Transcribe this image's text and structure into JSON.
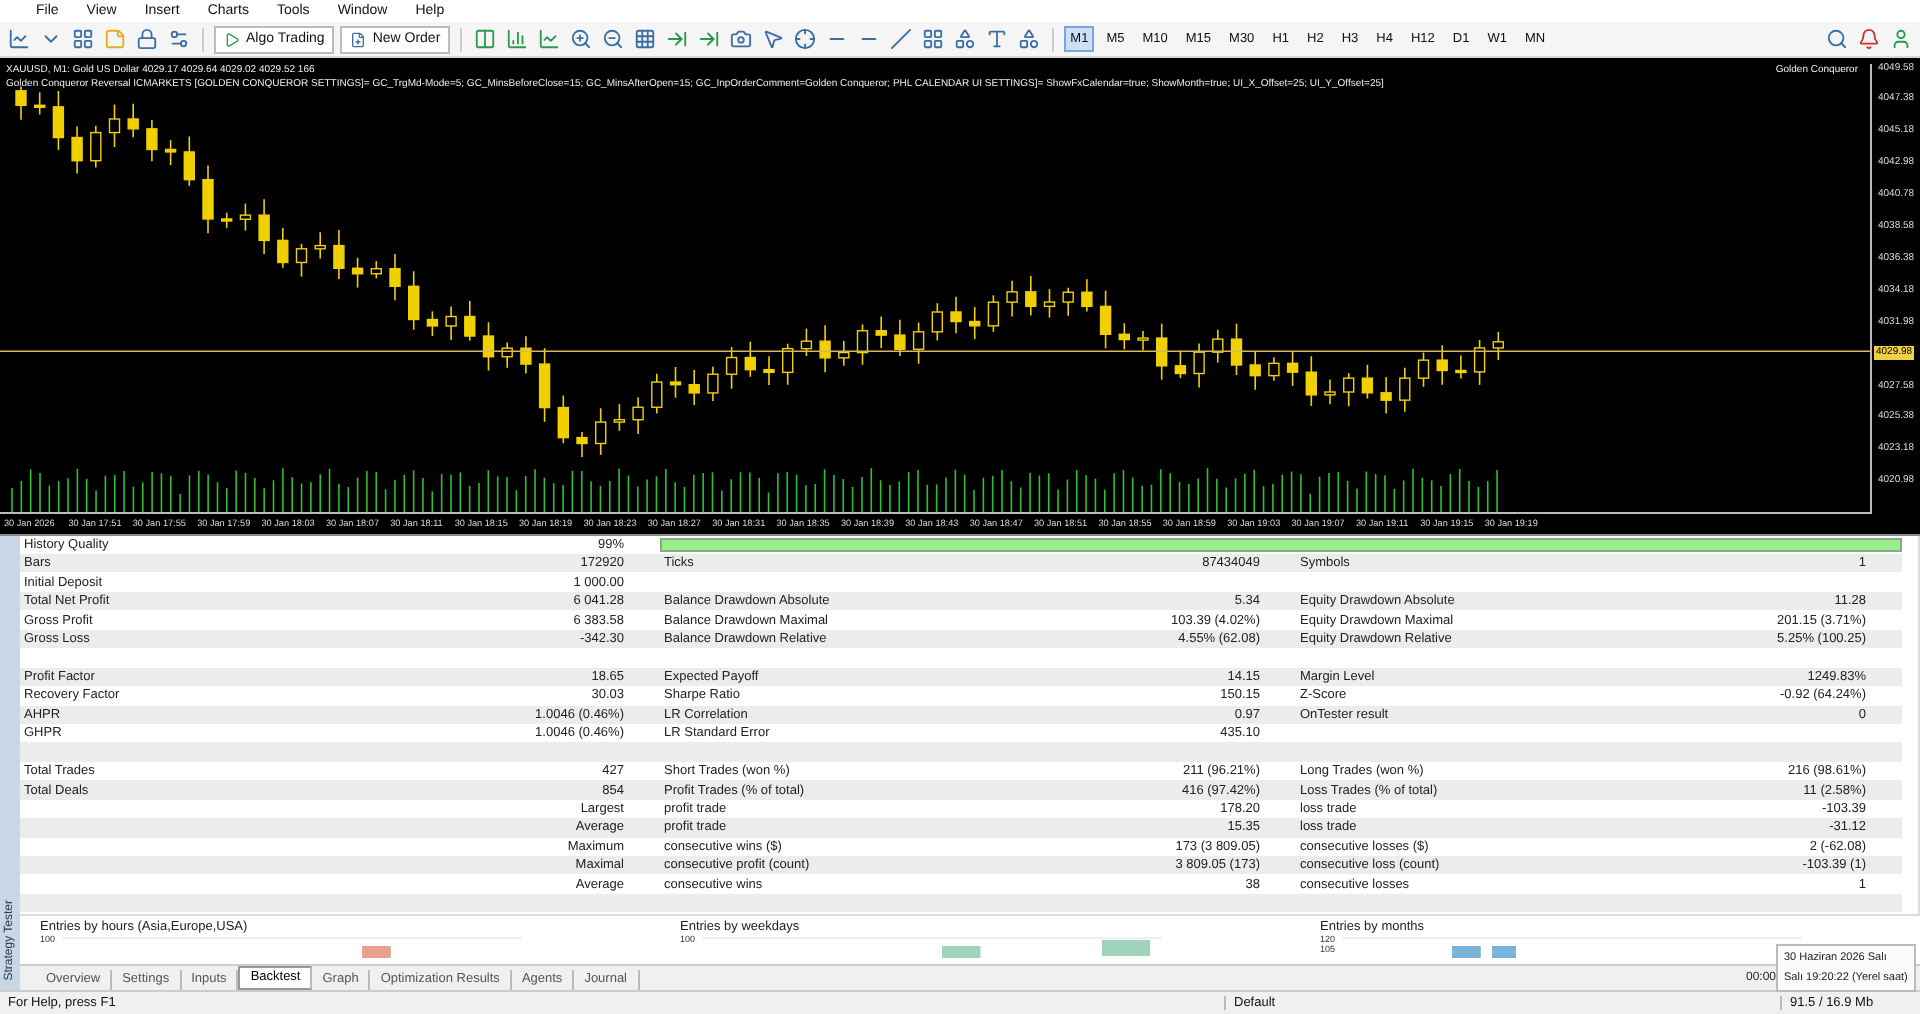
{
  "menu": [
    "File",
    "View",
    "Insert",
    "Charts",
    "Tools",
    "Window",
    "Help"
  ],
  "toolbar": {
    "algo_trading": "Algo Trading",
    "new_order": "New Order",
    "timeframes": [
      {
        "label": "M1",
        "selected": true
      },
      {
        "label": "M5",
        "selected": false
      },
      {
        "label": "M10",
        "selected": false
      },
      {
        "label": "M15",
        "selected": false
      },
      {
        "label": "M30",
        "selected": false
      },
      {
        "label": "H1",
        "selected": false
      },
      {
        "label": "H2",
        "selected": false
      },
      {
        "label": "H3",
        "selected": false
      },
      {
        "label": "H4",
        "selected": false
      },
      {
        "label": "H12",
        "selected": false
      },
      {
        "label": "D1",
        "selected": false
      },
      {
        "label": "W1",
        "selected": false
      },
      {
        "label": "MN",
        "selected": false
      }
    ]
  },
  "chart": {
    "info": "XAUUSD, M1:  Gold US Dollar  4029.17 4029.64 4029.02 4029.52  166",
    "expert_params": "Golden Conqueror Reversal ICMARKETS [GOLDEN CONQUEROR SETTINGS]= GC_TrgMd-Mode=5; GC_MinsBeforeClose=15; GC_MinsAfterOpen=15; GC_InpOrderComment=Golden Conqueror; PHL CALENDAR UI SETTINGS]= ShowFxCalendar=true; ShowMonth=true; UI_X_Offset=25; UI_Y_Offset=25]",
    "expert_name": "Golden Conqueror",
    "price_ticks": [
      {
        "kind": "tick",
        "label": "4049.58"
      },
      {
        "kind": "tick",
        "label": "4047.38"
      },
      {
        "kind": "tick",
        "label": "4045.18"
      },
      {
        "kind": "tick",
        "label": "4042.98"
      },
      {
        "kind": "tick",
        "label": "4040.78"
      },
      {
        "kind": "tick",
        "label": "4038.58"
      },
      {
        "kind": "tick",
        "label": "4036.38"
      },
      {
        "kind": "tick",
        "label": "4034.18"
      },
      {
        "kind": "tick",
        "label": "4031.98"
      },
      {
        "kind": "current",
        "label": "4029.98"
      },
      {
        "kind": "tick",
        "label": "4027.58"
      },
      {
        "kind": "tick",
        "label": "4025.38"
      },
      {
        "kind": "tick",
        "label": "4023.18"
      },
      {
        "kind": "tick",
        "label": "4020.98"
      }
    ],
    "time_ticks": [
      "30 Jan 2026",
      "30 Jan 17:51",
      "30 Jan 17:55",
      "30 Jan 17:59",
      "30 Jan 18:03",
      "30 Jan 18:07",
      "30 Jan 18:11",
      "30 Jan 18:15",
      "30 Jan 18:19",
      "30 Jan 18:23",
      "30 Jan 18:27",
      "30 Jan 18:31",
      "30 Jan 18:35",
      "30 Jan 18:39",
      "30 Jan 18:43",
      "30 Jan 18:47",
      "30 Jan 18:51",
      "30 Jan 18:55",
      "30 Jan 18:59",
      "30 Jan 19:03",
      "30 Jan 19:07",
      "30 Jan 19:11",
      "30 Jan 19:15",
      "30 Jan 19:19"
    ]
  },
  "side_label": "Strategy Tester",
  "report": {
    "rows": [
      {
        "kind": "quality",
        "label": "History Quality",
        "value": "99%",
        "level": 1
      },
      {
        "kind": "stats",
        "groups": [
          {
            "label": "Bars",
            "value": "172920"
          },
          {
            "label": "Ticks",
            "value": "87434049"
          },
          {
            "label": "Symbols",
            "value": "1"
          }
        ]
      },
      {
        "kind": "stats",
        "groups": [
          {
            "label": "Initial Deposit",
            "value": "1 000.00"
          }
        ]
      },
      {
        "kind": "stats",
        "groups": [
          {
            "label": "Total Net Profit",
            "value": "6 041.28"
          },
          {
            "label": "Balance Drawdown Absolute",
            "value": "5.34"
          },
          {
            "label": "Equity Drawdown Absolute",
            "value": "11.28"
          }
        ]
      },
      {
        "kind": "stats",
        "groups": [
          {
            "label": "Gross Profit",
            "value": "6 383.58"
          },
          {
            "label": "Balance Drawdown Maximal",
            "value": "103.39 (4.02%)"
          },
          {
            "label": "Equity Drawdown Maximal",
            "value": "201.15 (3.71%)"
          }
        ]
      },
      {
        "kind": "stats",
        "groups": [
          {
            "label": "Gross Loss",
            "value": "-342.30"
          },
          {
            "label": "Balance Drawdown Relative",
            "value": "4.55% (62.08)"
          },
          {
            "label": "Equity Drawdown Relative",
            "value": "5.25% (100.25)"
          }
        ]
      },
      {
        "kind": "blank"
      },
      {
        "kind": "stats",
        "groups": [
          {
            "label": "Profit Factor",
            "value": "18.65"
          },
          {
            "label": "Expected Payoff",
            "value": "14.15"
          },
          {
            "label": "Margin Level",
            "value": "1249.83%"
          }
        ]
      },
      {
        "kind": "stats",
        "groups": [
          {
            "label": "Recovery Factor",
            "value": "30.03"
          },
          {
            "label": "Sharpe Ratio",
            "value": "150.15"
          },
          {
            "label": "Z-Score",
            "value": "-0.92 (64.24%)"
          }
        ]
      },
      {
        "kind": "stats",
        "groups": [
          {
            "label": "AHPR",
            "value": "1.0046 (0.46%)"
          },
          {
            "label": "LR Correlation",
            "value": "0.97"
          },
          {
            "label": "OnTester result",
            "value": "0"
          }
        ]
      },
      {
        "kind": "stats",
        "groups": [
          {
            "label": "GHPR",
            "value": "1.0046 (0.46%)"
          },
          {
            "label": "LR Standard Error",
            "value": "435.10"
          }
        ]
      },
      {
        "kind": "blank"
      },
      {
        "kind": "stats",
        "groups": [
          {
            "label": "Total Trades",
            "value": "427"
          },
          {
            "label": "Short Trades (won %)",
            "value": "211 (96.21%)"
          },
          {
            "label": "Long Trades (won %)",
            "value": "216 (98.61%)"
          }
        ]
      },
      {
        "kind": "stats",
        "groups": [
          {
            "label": "Total Deals",
            "value": "854"
          },
          {
            "label": "Profit Trades (% of total)",
            "value": "416 (97.42%)"
          },
          {
            "label": "Loss Trades (% of total)",
            "value": "11 (2.58%)"
          }
        ]
      },
      {
        "kind": "sub",
        "caption": "Largest",
        "groups": [
          {
            "label": "profit trade",
            "value": "178.20"
          },
          {
            "label": "loss trade",
            "value": "-103.39"
          }
        ]
      },
      {
        "kind": "sub",
        "caption": "Average",
        "groups": [
          {
            "label": "profit trade",
            "value": "15.35"
          },
          {
            "label": "loss trade",
            "value": "-31.12"
          }
        ]
      },
      {
        "kind": "sub",
        "caption": "Maximum",
        "groups": [
          {
            "label": "consecutive wins ($)",
            "value": "173 (3 809.05)"
          },
          {
            "label": "consecutive losses ($)",
            "value": "2 (-62.08)"
          }
        ]
      },
      {
        "kind": "sub",
        "caption": "Maximal",
        "groups": [
          {
            "label": "consecutive profit (count)",
            "value": "3 809.05 (173)"
          },
          {
            "label": "consecutive loss (count)",
            "value": "-103.39 (1)"
          }
        ]
      },
      {
        "kind": "sub",
        "caption": "Average",
        "groups": [
          {
            "label": "consecutive wins",
            "value": "38"
          },
          {
            "label": "consecutive losses",
            "value": "1"
          }
        ]
      },
      {
        "kind": "blank"
      }
    ]
  },
  "distribution_charts": [
    {
      "title": "Entries by hours (Asia,Europe,USA)",
      "ticks": [
        "100"
      ],
      "color": "#e8a090"
    },
    {
      "title": "Entries by weekdays",
      "ticks": [
        "100"
      ],
      "color": "#9ed4bc"
    },
    {
      "title": "Entries by months",
      "ticks": [
        "120",
        "105"
      ],
      "color": "#7ab4d8"
    }
  ],
  "tabs": [
    {
      "label": "Overview",
      "selected": false
    },
    {
      "label": "Settings",
      "selected": false
    },
    {
      "label": "Inputs",
      "selected": false
    },
    {
      "label": "Backtest",
      "selected": true
    },
    {
      "label": "Graph",
      "selected": false
    },
    {
      "label": "Optimization Results",
      "selected": false
    },
    {
      "label": "Agents",
      "selected": false
    },
    {
      "label": "Journal",
      "selected": false
    }
  ],
  "tab_bar_time": "00:00",
  "clock_tooltip": {
    "date": "30 Haziran 2026 Salı",
    "time": "Salı 19:20:22 (Yerel saat)"
  },
  "status_bar": {
    "help": "For Help, press F1",
    "profile": "Default",
    "memory": "91.5 / 16.9 Mb"
  }
}
